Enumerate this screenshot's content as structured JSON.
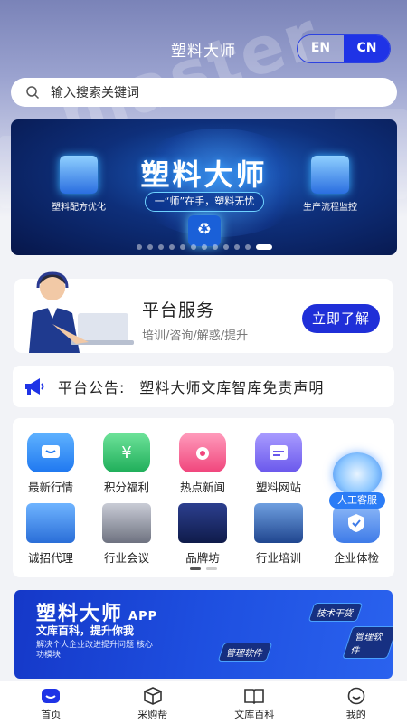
{
  "header": {
    "title": "塑料大师",
    "lang_en": "EN",
    "lang_cn": "CN"
  },
  "search": {
    "placeholder": "输入搜索关键词"
  },
  "banner": {
    "title": "塑料大师",
    "slogan": "一“师”在手，塑料无忧",
    "left_label": "塑料配方优化",
    "right_label": "生产流程监控"
  },
  "service": {
    "title": "平台服务",
    "subtitle": "培训/咨询/解惑/提升",
    "button": "立即了解"
  },
  "notice": {
    "label": "平台公告:",
    "text": "塑料大师文库智库免责声明"
  },
  "grid": {
    "items": [
      {
        "label": "最新行情",
        "icon": "message-icon",
        "color": "#2f8ef5"
      },
      {
        "label": "积分福利",
        "icon": "money-bag-icon",
        "color": "#2fbf6a"
      },
      {
        "label": "热点新闻",
        "icon": "flame-icon",
        "color": "#f25b86"
      },
      {
        "label": "塑料网站",
        "icon": "browser-icon",
        "color": "#7b6cf0"
      },
      {
        "label": "诚招代理",
        "icon": "handshake-icon",
        "color": "#2a7de8"
      },
      {
        "label": "行业会议",
        "icon": "meeting-photo",
        "color": "#8c8f99"
      },
      {
        "label": "品牌坊",
        "icon": "arch-photo",
        "color": "#2a4aa8"
      },
      {
        "label": "行业培训",
        "icon": "factory-photo",
        "color": "#3a6fbf"
      },
      {
        "label": "企业体检",
        "icon": "shield-check-icon",
        "color": "#3e7be8"
      }
    ]
  },
  "customer_service": {
    "label": "人工客服"
  },
  "promo": {
    "title": "塑料大师",
    "app": "APP",
    "subtitle": "文库百科，提升你我",
    "description": "解决个人企业改进提升问题 核心功模块",
    "card1": "技术干货",
    "card2": "管理软件",
    "card3": "管理软件"
  },
  "nav": {
    "items": [
      {
        "label": "首页",
        "icon": "home-icon"
      },
      {
        "label": "采购帮",
        "icon": "box-icon"
      },
      {
        "label": "文库百科",
        "icon": "book-icon"
      },
      {
        "label": "我的",
        "icon": "profile-icon"
      }
    ]
  }
}
